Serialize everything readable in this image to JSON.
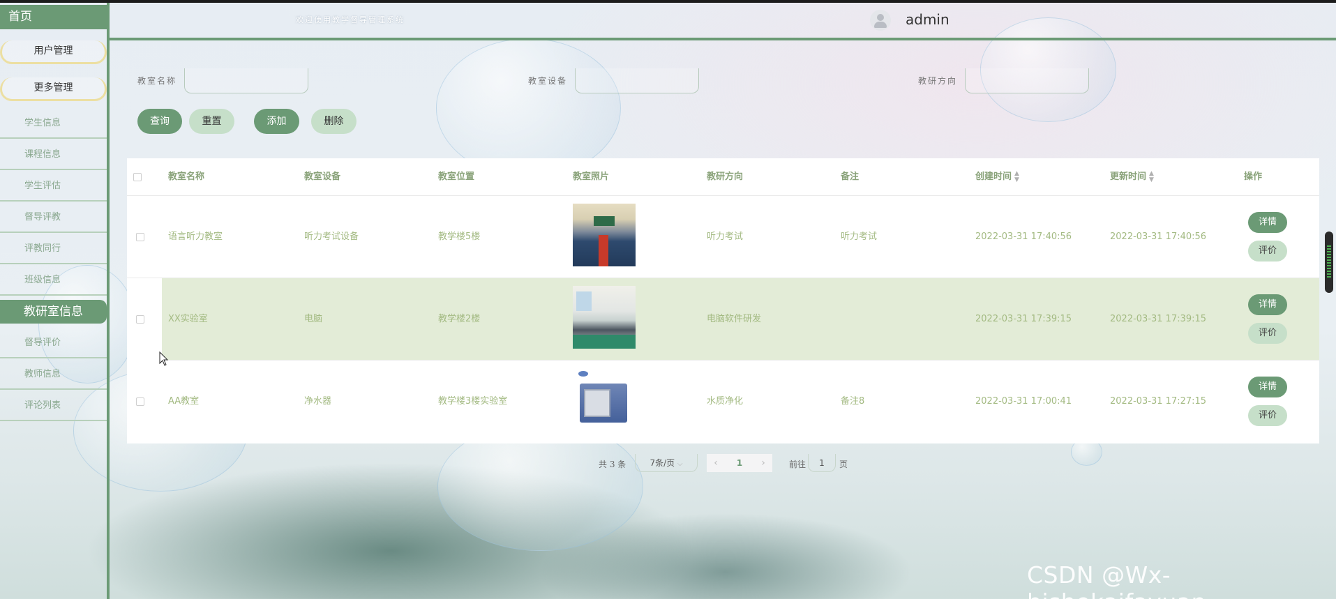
{
  "header": {
    "welcome": "欢迎使用教学督导管理系统",
    "username": "admin"
  },
  "sidebar": {
    "home": "首页",
    "groups": [
      "用户管理",
      "更多管理"
    ],
    "items": [
      "学生信息",
      "课程信息",
      "学生评估",
      "督导评教",
      "评教同行",
      "班级信息"
    ],
    "section": "教研室信息",
    "section_items": [
      "督导评价",
      "教师信息",
      "评论列表"
    ]
  },
  "search": {
    "name_label": "教室名称",
    "name_value": "",
    "equipment_label": "教室设备",
    "equipment_value": "",
    "direction_label": "教研方向",
    "direction_value": "",
    "query_button": "查询",
    "reset_button": "重置",
    "add_button": "添加",
    "delete_button": "删除"
  },
  "table": {
    "columns": [
      "教室名称",
      "教室设备",
      "教室位置",
      "教室照片",
      "教研方向",
      "备注",
      "创建时间",
      "更新时间",
      "操作"
    ],
    "rows": [
      {
        "name": "语言听力教室",
        "equipment": "听力考试设备",
        "location": "教学楼5楼",
        "photo": "classroom-photo",
        "direction": "听力考试",
        "note": "听力考试",
        "created": "2022-03-31 17:40:56",
        "updated": "2022-03-31 17:40:56",
        "detail": "详情",
        "review": "评价"
      },
      {
        "name": "XX实验室",
        "equipment": "电脑",
        "location": "教学楼2楼",
        "photo": "computer-lab-photo",
        "direction": "电脑软件研发",
        "note": "",
        "created": "2022-03-31 17:39:15",
        "updated": "2022-03-31 17:39:15",
        "detail": "详情",
        "review": "评价"
      },
      {
        "name": "AA教室",
        "equipment": "净水器",
        "location": "教学楼3楼实验室",
        "photo": "oven-equipment-photo",
        "direction": "水质净化",
        "note": "备注8",
        "created": "2022-03-31 17:00:41",
        "updated": "2022-03-31 17:27:15",
        "detail": "详情",
        "review": "评价"
      }
    ]
  },
  "pagination": {
    "total": "共 3 条",
    "page_size": "7条/页",
    "current_page": "1",
    "goto_label": "前往",
    "goto_value": "1",
    "page_suffix": "页"
  },
  "watermark": "CSDN @Wx-bishekaifayuan",
  "colors": {
    "accent": "#6b9a75",
    "accent_light": "#c6dfc9",
    "row_highlight": "#e3ecd7",
    "cell_text": "#a3ba82"
  }
}
